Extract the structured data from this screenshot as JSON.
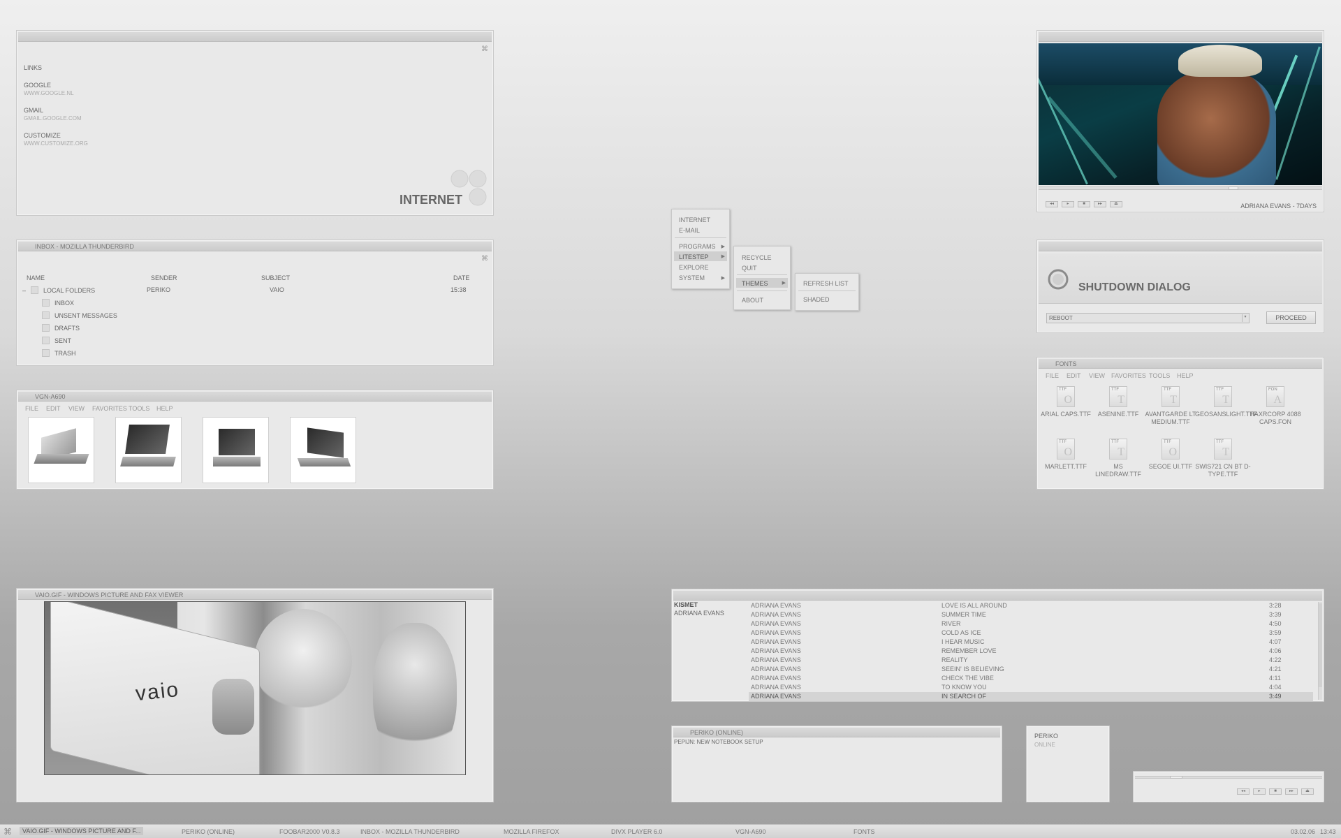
{
  "internet_panel": {
    "links_heading": "LINKS",
    "links": [
      {
        "name": "GOOGLE",
        "url": "WWW.GOOGLE.NL"
      },
      {
        "name": "GMAIL",
        "url": "GMAIL.GOOGLE.COM"
      },
      {
        "name": "CUSTOMIZE",
        "url": "WWW.CUSTOMIZE.ORG"
      }
    ],
    "footer": "INTERNET"
  },
  "thunderbird": {
    "title": "INBOX - MOZILLA THUNDERBIRD",
    "columns": {
      "name": "NAME",
      "sender": "SENDER",
      "subject": "SUBJECT",
      "date": "DATE"
    },
    "root": {
      "expander": "–",
      "name": "LOCAL FOLDERS",
      "sender": "PERIKO",
      "subject": "VAIO",
      "date": "15:38"
    },
    "folders": [
      "INBOX",
      "UNSENT MESSAGES",
      "DRAFTS",
      "SENT",
      "TRASH"
    ]
  },
  "vgn": {
    "title": "VGN-A690",
    "menu": [
      "FILE",
      "EDIT",
      "VIEW",
      "FAVORITES",
      "TOOLS",
      "HELP"
    ]
  },
  "picviewer": {
    "title": "VAIO.GIF - WINDOWS PICTURE AND FAX VIEWER",
    "logo": "VAIO"
  },
  "start_menu": {
    "main": [
      {
        "label": "INTERNET"
      },
      {
        "label": "E-MAIL"
      },
      {
        "label": "PROGRAMS"
      },
      {
        "label": "LITESTEP"
      },
      {
        "label": "EXPLORE"
      },
      {
        "label": "SYSTEM"
      }
    ],
    "litestep": [
      "RECYCLE",
      "QUIT",
      "THEMES",
      "ABOUT"
    ],
    "themes": [
      "REFRESH LIST",
      "SHADED"
    ]
  },
  "divx": {
    "now_playing": "ADRIANA EVANS - 7DAYS",
    "buttons": [
      "◂◂",
      "▸",
      "■",
      "▸▸",
      "⏏"
    ]
  },
  "shutdown": {
    "title": "SHUTDOWN DIALOG",
    "select_value": "REBOOT",
    "proceed_label": "PROCEED"
  },
  "fonts_window": {
    "title": "FONTS",
    "menu": [
      "FILE",
      "EDIT",
      "VIEW",
      "FAVORITES",
      "TOOLS",
      "HELP"
    ],
    "fonts": [
      {
        "ext": "TTF",
        "glyph": "O",
        "name": "ARIAL CAPS.TTF"
      },
      {
        "ext": "TTF",
        "glyph": "T",
        "name": "ASENINE.TTF"
      },
      {
        "ext": "TTF",
        "glyph": "T",
        "name": "AVANTGARDE LT MEDIUM.TTF"
      },
      {
        "ext": "TTF",
        "glyph": "T",
        "name": "GEOSANSLIGHT.TTF"
      },
      {
        "ext": "FON",
        "glyph": "A",
        "name": "HAXRCORP 4088 CAPS.FON"
      },
      {
        "ext": "TTF",
        "glyph": "O",
        "name": "MARLETT.TTF"
      },
      {
        "ext": "TTF",
        "glyph": "T",
        "name": "MS LINEDRAW.TTF"
      },
      {
        "ext": "TTF",
        "glyph": "O",
        "name": "SEGOE UI.TTF"
      },
      {
        "ext": "TTF",
        "glyph": "T",
        "name": "SWIS721 CN BT D-TYPE.TTF"
      }
    ]
  },
  "playlist": {
    "album": "KISMET",
    "artist": "ADRIANA EVANS",
    "tracks": [
      {
        "artist": "ADRIANA EVANS",
        "title": "LOVE IS ALL AROUND",
        "time": "3:28"
      },
      {
        "artist": "ADRIANA EVANS",
        "title": "SUMMER TIME",
        "time": "3:39"
      },
      {
        "artist": "ADRIANA EVANS",
        "title": "RIVER",
        "time": "4:50"
      },
      {
        "artist": "ADRIANA EVANS",
        "title": "COLD AS ICE",
        "time": "3:59"
      },
      {
        "artist": "ADRIANA EVANS",
        "title": "I HEAR MUSIC",
        "time": "4:07"
      },
      {
        "artist": "ADRIANA EVANS",
        "title": "REMEMBER LOVE",
        "time": "4:06"
      },
      {
        "artist": "ADRIANA EVANS",
        "title": "REALITY",
        "time": "4:22"
      },
      {
        "artist": "ADRIANA EVANS",
        "title": "SEEIN' IS BELIEVING",
        "time": "4:21"
      },
      {
        "artist": "ADRIANA EVANS",
        "title": "CHECK THE VIBE",
        "time": "4:11"
      },
      {
        "artist": "ADRIANA EVANS",
        "title": "TO KNOW YOU",
        "time": "4:04"
      },
      {
        "artist": "ADRIANA EVANS",
        "title": "IN SEARCH OF",
        "time": "3:49"
      }
    ]
  },
  "chat": {
    "title": "PERIKO (ONLINE)",
    "message": "PEPIJN: NEW NOTEBOOK SETUP"
  },
  "contact": {
    "name": "PERIKO",
    "status": "ONLINE"
  },
  "mini_player": {
    "buttons": [
      "◂◂",
      "▸",
      "■",
      "▸▸",
      "⏏"
    ]
  },
  "taskbar": {
    "tasks": [
      "VAIO.GIF - WINDOWS PICTURE AND F...",
      "PERIKO (ONLINE)",
      "FOOBAR2000 V0.8.3",
      "INBOX - MOZILLA THUNDERBIRD",
      "MOZILLA FIREFOX",
      "DIVX PLAYER 6.0",
      "VGN-A690",
      "FONTS"
    ],
    "date": "03.02.06",
    "time": "13:43"
  }
}
